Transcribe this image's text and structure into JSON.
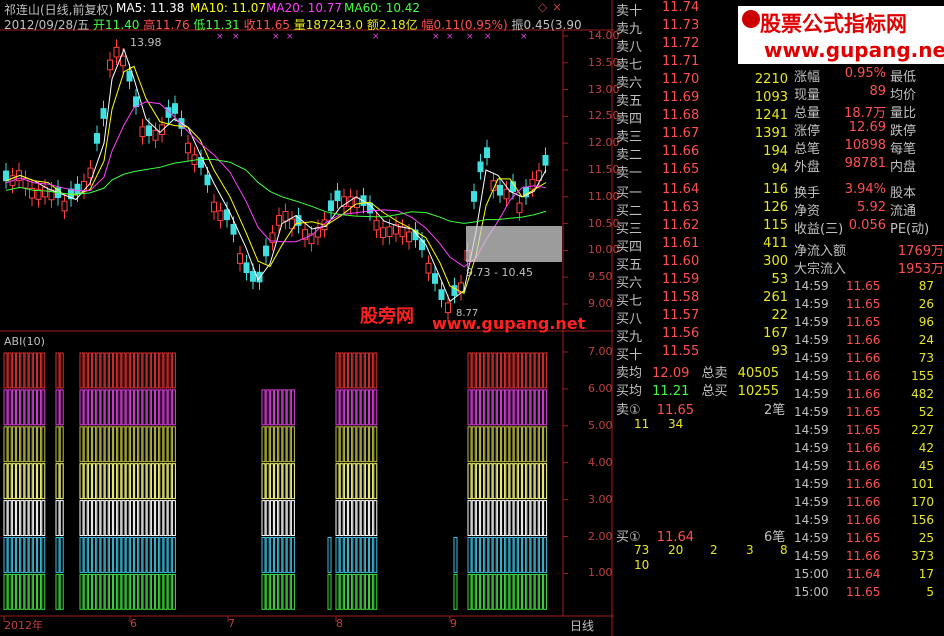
{
  "header": {
    "title": "祁连山(日线,前复权)",
    "ma_labels": [
      {
        "text": "MA5: 11.38",
        "color": "#ffffff"
      },
      {
        "text": "MA10: 11.07",
        "color": "#ffff00"
      },
      {
        "text": "MA20: 10.77",
        "color": "#ff40ff"
      },
      {
        "text": "MA60: 10.42",
        "color": "#40ff40"
      }
    ],
    "date_line": "2012/09/28/五",
    "open": "开11.40",
    "high": "高11.76",
    "low": "低11.31",
    "close": "收11.65",
    "volume": "量187243.0",
    "amount": "额2.18亿",
    "change": "幅0.11(0.95%)",
    "amplitude": "振0.45(3.90"
  },
  "chart_annotations": {
    "max_label": "13.98",
    "range_label": "9.73 - 10.45",
    "min_label": "8.77",
    "watermark_cn": "股旁网",
    "watermark_url": "www.gupang.net"
  },
  "brand": {
    "logo_text": "股票公式指标网",
    "logo_url": "www.gupang.net"
  },
  "price_axis": [
    "14.00",
    "13.50",
    "13.00",
    "12.50",
    "12.00",
    "11.50",
    "11.00",
    "10.50",
    "10.00",
    "9.50",
    "9.00"
  ],
  "indicator": {
    "name": "ABI(10)",
    "axis": [
      "7.00",
      "6.00",
      "5.00",
      "4.00",
      "3.00",
      "2.00",
      "1.00"
    ],
    "colors": [
      "#40e040",
      "#40c0e0",
      "#ffffff",
      "#ffff80",
      "#c0c040",
      "#e040e0",
      "#e03030"
    ]
  },
  "time_axis": {
    "labels": [
      "2012年",
      "6",
      "7",
      "8",
      "9"
    ],
    "period": "日线"
  },
  "order_book": {
    "sell": [
      {
        "label": "卖十",
        "price": "11.74",
        "volume": ""
      },
      {
        "label": "卖九",
        "price": "11.73",
        "volume": ""
      },
      {
        "label": "卖八",
        "price": "11.72",
        "volume": ""
      },
      {
        "label": "卖七",
        "price": "11.71",
        "volume": ""
      },
      {
        "label": "卖六",
        "price": "11.70",
        "volume": "2210"
      },
      {
        "label": "卖五",
        "price": "11.69",
        "volume": "1093"
      },
      {
        "label": "卖四",
        "price": "11.68",
        "volume": "1241"
      },
      {
        "label": "卖三",
        "price": "11.67",
        "volume": "1391"
      },
      {
        "label": "卖二",
        "price": "11.66",
        "volume": "194"
      },
      {
        "label": "卖一",
        "price": "11.65",
        "volume": "94"
      }
    ],
    "buy": [
      {
        "label": "买一",
        "price": "11.64",
        "volume": "116"
      },
      {
        "label": "买二",
        "price": "11.63",
        "volume": "126"
      },
      {
        "label": "买三",
        "price": "11.62",
        "volume": "115"
      },
      {
        "label": "买四",
        "price": "11.61",
        "volume": "411"
      },
      {
        "label": "买五",
        "price": "11.60",
        "volume": "300"
      },
      {
        "label": "买六",
        "price": "11.59",
        "volume": "53"
      },
      {
        "label": "买七",
        "price": "11.58",
        "volume": "261"
      },
      {
        "label": "买八",
        "price": "11.57",
        "volume": "22"
      },
      {
        "label": "买九",
        "price": "11.56",
        "volume": "167"
      },
      {
        "label": "买十",
        "price": "11.55",
        "volume": "93"
      }
    ],
    "sell_avg_label": "卖均",
    "sell_avg": "12.09",
    "sell_total_label": "总卖",
    "sell_total": "40505",
    "buy_avg_label": "买均",
    "buy_avg": "11.21",
    "buy_total_label": "总买",
    "buy_total": "10255",
    "queue_sell_label": "卖①",
    "queue_sell_price": "11.65",
    "queue_sell_count": "2笔",
    "queue_sell_items": [
      "11",
      "34"
    ],
    "queue_buy_label": "买①",
    "queue_buy_price": "11.64",
    "queue_buy_count": "6笔",
    "queue_buy_items": [
      "73",
      "20",
      "2",
      "3",
      "8",
      "10"
    ]
  },
  "stats": [
    {
      "k": "涨幅",
      "v": "0.95%",
      "k2": "最低"
    },
    {
      "k": "现量",
      "v": "89",
      "k2": "均价"
    },
    {
      "k": "总量",
      "v": "18.7万",
      "k2": "量比"
    },
    {
      "k": "涨停",
      "v": "12.69",
      "k2": "跌停"
    },
    {
      "k": "总笔",
      "v": "10898",
      "k2": "每笔"
    },
    {
      "k": "外盘",
      "v": "98781",
      "k2": "内盘"
    }
  ],
  "stats2": [
    {
      "k": "换手",
      "v": "3.94%",
      "k2": "股本"
    },
    {
      "k": "净资",
      "v": "5.92",
      "k2": "流通"
    },
    {
      "k": "收益(三)",
      "v": "0.056",
      "k2": "PE(动)"
    }
  ],
  "flows": [
    {
      "k": "净流入额",
      "v": "1769万"
    },
    {
      "k": "大宗流入",
      "v": "1953万"
    }
  ],
  "ticks": [
    {
      "t": "14:59",
      "p": "11.65",
      "q": "87"
    },
    {
      "t": "14:59",
      "p": "11.65",
      "q": "26"
    },
    {
      "t": "14:59",
      "p": "11.65",
      "q": "96"
    },
    {
      "t": "14:59",
      "p": "11.66",
      "q": "24"
    },
    {
      "t": "14:59",
      "p": "11.66",
      "q": "73"
    },
    {
      "t": "14:59",
      "p": "11.66",
      "q": "155"
    },
    {
      "t": "14:59",
      "p": "11.66",
      "q": "482"
    },
    {
      "t": "14:59",
      "p": "11.65",
      "q": "52"
    },
    {
      "t": "14:59",
      "p": "11.65",
      "q": "227"
    },
    {
      "t": "14:59",
      "p": "11.66",
      "q": "42"
    },
    {
      "t": "14:59",
      "p": "11.66",
      "q": "45"
    },
    {
      "t": "14:59",
      "p": "11.66",
      "q": "101"
    },
    {
      "t": "14:59",
      "p": "11.66",
      "q": "170"
    },
    {
      "t": "14:59",
      "p": "11.66",
      "q": "156"
    },
    {
      "t": "14:59",
      "p": "11.65",
      "q": "25"
    },
    {
      "t": "14:59",
      "p": "11.66",
      "q": "373"
    },
    {
      "t": "15:00",
      "p": "11.64",
      "q": "17"
    },
    {
      "t": "15:00",
      "p": "11.65",
      "q": "5"
    }
  ]
}
